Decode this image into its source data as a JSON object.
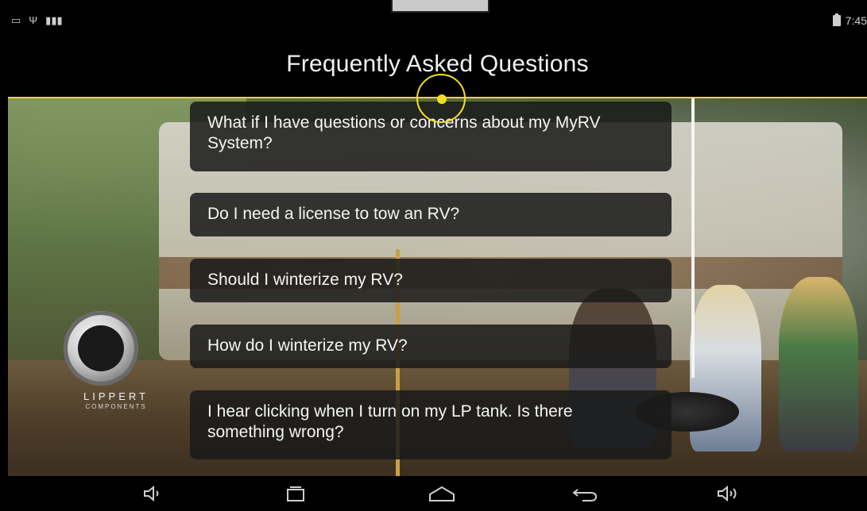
{
  "status_bar": {
    "time": "7:45",
    "left_icons": [
      "image-icon",
      "usb-icon",
      "barcode-icon"
    ],
    "right_icons": [
      "battery-charging-icon"
    ]
  },
  "header": {
    "title": "Frequently Asked Questions"
  },
  "faq": {
    "items": [
      {
        "question": "What if I have questions or concerns about my MyRV System?"
      },
      {
        "question": "Do I need a license to tow an RV?"
      },
      {
        "question": "Should I winterize my RV?"
      },
      {
        "question": "How do I winterize my RV?"
      },
      {
        "question": "I hear clicking when I turn on my LP tank. Is there something wrong?"
      }
    ]
  },
  "brand": {
    "name": "LIPPERT",
    "sub": "COMPONENTS"
  },
  "navbar": {
    "buttons": [
      "volume-down-icon",
      "recents-icon",
      "home-icon",
      "back-icon",
      "volume-up-icon"
    ]
  },
  "colors": {
    "accent": "#e6d640",
    "touch_indicator": "#f2e020",
    "faq_background": "#1a1a1a"
  }
}
